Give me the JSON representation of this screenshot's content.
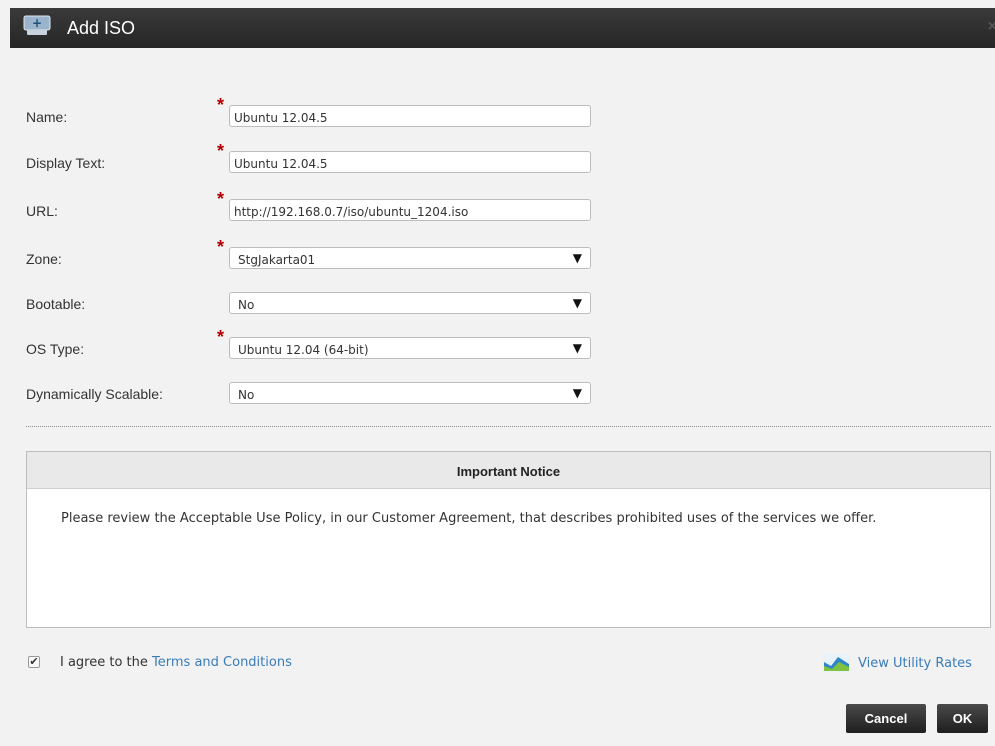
{
  "dialog": {
    "title": "Add ISO",
    "close_label": "×"
  },
  "form": {
    "name": {
      "label": "Name:",
      "value": "Ubuntu 12.04.5",
      "required": true
    },
    "display_text": {
      "label": "Display Text:",
      "value": "Ubuntu 12.04.5",
      "required": true
    },
    "url": {
      "label": "URL:",
      "value": "http://192.168.0.7/iso/ubuntu_1204.iso",
      "required": true
    },
    "zone": {
      "label": "Zone:",
      "value": "StgJakarta01",
      "required": true
    },
    "bootable": {
      "label": "Bootable:",
      "value": "No",
      "required": false
    },
    "os_type": {
      "label": "OS Type:",
      "value": "Ubuntu 12.04 (64-bit)",
      "required": true
    },
    "dynamically_scalable": {
      "label": "Dynamically Scalable:",
      "value": "No",
      "required": false
    },
    "required_marker": "*",
    "dropdown_arrow": "▼"
  },
  "notice": {
    "heading": "Important Notice",
    "body": "Please review the Acceptable Use Policy, in our Customer Agreement, that describes prohibited uses of the services we offer."
  },
  "agree": {
    "checked": true,
    "check_mark": "✔",
    "prefix": "I agree to the ",
    "link": "Terms and Conditions"
  },
  "utility": {
    "link": "View Utility Rates",
    "icon": "chart-icon"
  },
  "buttons": {
    "cancel": "Cancel",
    "ok": "OK"
  },
  "colors": {
    "title_bar": "#2b2b2b",
    "required": "#b40000",
    "link": "#3a7cb8",
    "button": "#2a2a2a"
  }
}
